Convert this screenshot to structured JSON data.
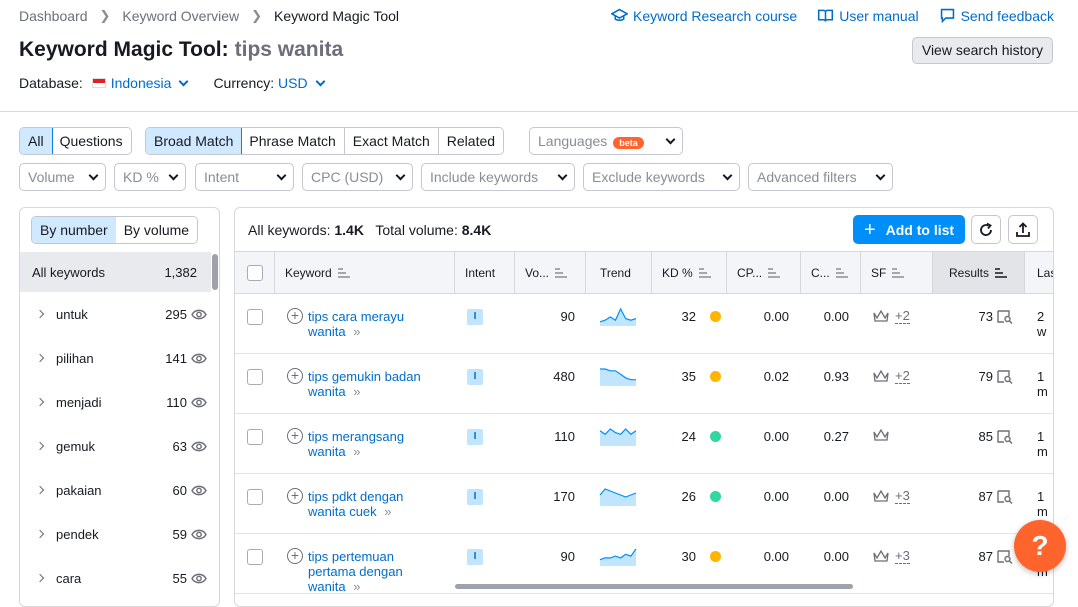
{
  "breadcrumb": [
    "Dashboard",
    "Keyword Overview",
    "Keyword Magic Tool"
  ],
  "top_links": {
    "course": "Keyword Research course",
    "manual": "User manual",
    "feedback": "Send feedback"
  },
  "title": {
    "tool": "Keyword Magic Tool:",
    "query": "tips wanita"
  },
  "history_button": "View search history",
  "database": {
    "label": "Database:",
    "value": "Indonesia"
  },
  "currency": {
    "label": "Currency:",
    "value": "USD"
  },
  "colors": {
    "accent": "#006dca",
    "primary_button": "#008ff8",
    "selected_bg": "#d1e9ff",
    "kd_yellow": "#ffb400",
    "kd_green": "#33d69f",
    "help": "#ff642d"
  },
  "tabs_type": [
    "All",
    "Questions"
  ],
  "tabs_match": [
    "Broad Match",
    "Phrase Match",
    "Exact Match",
    "Related"
  ],
  "languages": {
    "label": "Languages",
    "badge": "beta"
  },
  "filters": [
    "Volume",
    "KD %",
    "Intent",
    "CPC (USD)",
    "Include keywords",
    "Exclude keywords",
    "Advanced filters"
  ],
  "left": {
    "toggle": [
      "By number",
      "By volume"
    ],
    "all_label": "All keywords",
    "all_count": "1,382",
    "groups": [
      {
        "name": "untuk",
        "count": "295"
      },
      {
        "name": "pilihan",
        "count": "141"
      },
      {
        "name": "menjadi",
        "count": "110"
      },
      {
        "name": "gemuk",
        "count": "63"
      },
      {
        "name": "pakaian",
        "count": "60"
      },
      {
        "name": "pendek",
        "count": "59"
      },
      {
        "name": "cara",
        "count": "55"
      }
    ]
  },
  "summary": {
    "kw_label": "All keywords:",
    "kw_value": "1.4K",
    "vol_label": "Total volume:",
    "vol_value": "8.4K"
  },
  "add_button": "Add to list",
  "columns": [
    "Keyword",
    "Intent",
    "Vo...",
    "Trend",
    "KD %",
    "CP...",
    "C...",
    "SF",
    "Results",
    "Las"
  ],
  "rows": [
    {
      "kw1": "tips cara merayu",
      "kw2": "wanita",
      "intent": "I",
      "volume": "90",
      "kd": "32",
      "kd_color": "#ffb400",
      "cpc": "0.00",
      "com": "0.00",
      "sf": "+2",
      "results": "73",
      "last": "2 w",
      "trend": [
        2,
        3,
        5,
        3,
        10,
        4,
        3,
        4
      ]
    },
    {
      "kw1": "tips gemukin badan",
      "kw2": "wanita",
      "intent": "I",
      "volume": "480",
      "kd": "35",
      "kd_color": "#ffb400",
      "cpc": "0.02",
      "com": "0.93",
      "sf": "+2",
      "results": "79",
      "last": "1 m",
      "trend": [
        9,
        9,
        8,
        8,
        6,
        4,
        3,
        3
      ]
    },
    {
      "kw1": "tips merangsang",
      "kw2": "wanita",
      "intent": "I",
      "volume": "110",
      "kd": "24",
      "kd_color": "#33d69f",
      "cpc": "0.00",
      "com": "0.27",
      "sf": "",
      "results": "85",
      "last": "1 m",
      "trend": [
        8,
        6,
        9,
        7,
        6,
        9,
        6,
        8
      ]
    },
    {
      "kw1": "tips pdkt dengan",
      "kw2": "wanita cuek",
      "intent": "I",
      "volume": "170",
      "kd": "26",
      "kd_color": "#33d69f",
      "cpc": "0.00",
      "com": "0.00",
      "sf": "+3",
      "results": "87",
      "last": "1 m",
      "trend": [
        5,
        8,
        7,
        6,
        5,
        4,
        5,
        6
      ]
    },
    {
      "kw1": "tips pertemuan",
      "kw2": "pertama dengan",
      "kw3": "wanita",
      "intent": "I",
      "volume": "90",
      "kd": "30",
      "kd_color": "#ffb400",
      "cpc": "0.00",
      "com": "0.00",
      "sf": "+3",
      "results": "87",
      "last": "1 m",
      "trend": [
        3,
        4,
        4,
        5,
        4,
        6,
        5,
        9
      ]
    }
  ],
  "help_label": "?"
}
